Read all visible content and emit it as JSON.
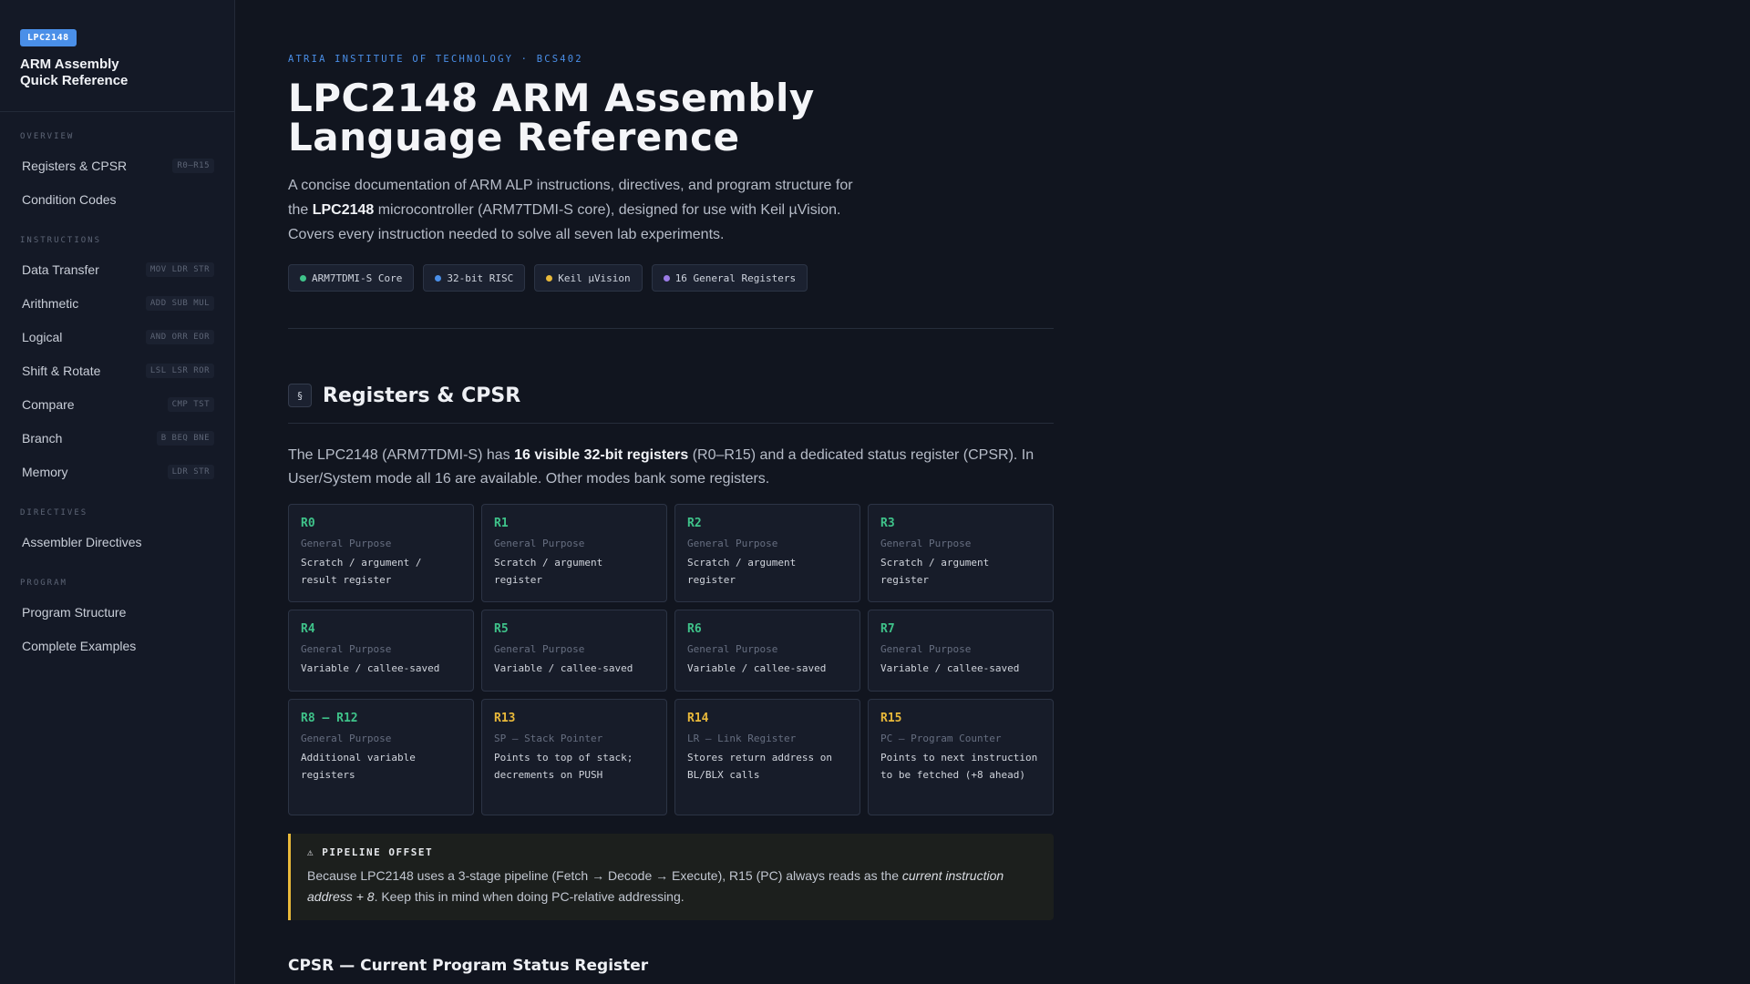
{
  "sidebar": {
    "badge": "LPC2148",
    "title": "ARM Assembly Quick Reference",
    "sections": [
      {
        "label": "OVERVIEW",
        "items": [
          {
            "label": "Registers & CPSR",
            "tag": "R0–R15"
          },
          {
            "label": "Condition Codes",
            "tag": ""
          }
        ]
      },
      {
        "label": "INSTRUCTIONS",
        "items": [
          {
            "label": "Data Transfer",
            "tag": "MOV LDR STR"
          },
          {
            "label": "Arithmetic",
            "tag": "ADD SUB MUL"
          },
          {
            "label": "Logical",
            "tag": "AND ORR EOR"
          },
          {
            "label": "Shift & Rotate",
            "tag": "LSL LSR ROR"
          },
          {
            "label": "Compare",
            "tag": "CMP TST"
          },
          {
            "label": "Branch",
            "tag": "B BEQ BNE"
          },
          {
            "label": "Memory",
            "tag": "LDR STR"
          }
        ]
      },
      {
        "label": "DIRECTIVES",
        "items": [
          {
            "label": "Assembler Directives",
            "tag": ""
          }
        ]
      },
      {
        "label": "PROGRAM",
        "items": [
          {
            "label": "Program Structure",
            "tag": ""
          },
          {
            "label": "Complete Examples",
            "tag": ""
          }
        ]
      }
    ]
  },
  "header": {
    "eyebrow": "ATRIA INSTITUTE OF TECHNOLOGY · BCS402",
    "title": "LPC2148 ARM Assembly Language Reference",
    "intro_pre": "A concise documentation of ARM ALP instructions, directives, and program structure for the ",
    "intro_bold": "LPC2148",
    "intro_post": " microcontroller (ARM7TDMI-S core), designed for use with Keil µVision. Covers every instruction needed to solve all seven lab experiments.",
    "pills": [
      {
        "label": "ARM7TDMI-S Core",
        "color": "#3fc38a"
      },
      {
        "label": "32-bit RISC",
        "color": "#4a8fe8"
      },
      {
        "label": "Keil µVision",
        "color": "#e9b93a"
      },
      {
        "label": "16 General Registers",
        "color": "#9b7be6"
      }
    ]
  },
  "registers_section": {
    "icon": "§",
    "title": "Registers & CPSR",
    "para_pre": "The LPC2148 (ARM7TDMI-S) has ",
    "para_bold": "16 visible 32-bit registers",
    "para_post": " (R0–R15) and a dedicated status register (CPSR). In User/System mode all 16 are available. Other modes bank some registers.",
    "cards": [
      {
        "name": "R0",
        "role": "General Purpose",
        "desc": "Scratch / argument / result register",
        "special": false
      },
      {
        "name": "R1",
        "role": "General Purpose",
        "desc": "Scratch / argument register",
        "special": false
      },
      {
        "name": "R2",
        "role": "General Purpose",
        "desc": "Scratch / argument register",
        "special": false
      },
      {
        "name": "R3",
        "role": "General Purpose",
        "desc": "Scratch / argument register",
        "special": false
      },
      {
        "name": "R4",
        "role": "General Purpose",
        "desc": "Variable / callee-saved",
        "special": false
      },
      {
        "name": "R5",
        "role": "General Purpose",
        "desc": "Variable / callee-saved",
        "special": false
      },
      {
        "name": "R6",
        "role": "General Purpose",
        "desc": "Variable / callee-saved",
        "special": false
      },
      {
        "name": "R7",
        "role": "General Purpose",
        "desc": "Variable / callee-saved",
        "special": false
      },
      {
        "name": "R8 – R12",
        "role": "General Purpose",
        "desc": "Additional variable registers",
        "special": false
      },
      {
        "name": "R13",
        "role": "SP — Stack Pointer",
        "desc": "Points to top of stack; decrements on PUSH",
        "special": true
      },
      {
        "name": "R14",
        "role": "LR — Link Register",
        "desc": "Stores return address on BL/BLX calls",
        "special": true
      },
      {
        "name": "R15",
        "role": "PC — Program Counter",
        "desc": "Points to next instruction to be fetched (+8 ahead)",
        "special": true
      }
    ],
    "callout": {
      "icon": "⚠",
      "title": "PIPELINE OFFSET",
      "text_pre": "Because LPC2148 uses a 3-stage pipeline (Fetch → Decode → Execute), R15 (PC) always reads as the ",
      "text_italic": "current instruction address + 8",
      "text_post": ". Keep this in mind when doing PC-relative addressing."
    },
    "cpsr_title": "CPSR — Current Program Status Register"
  }
}
